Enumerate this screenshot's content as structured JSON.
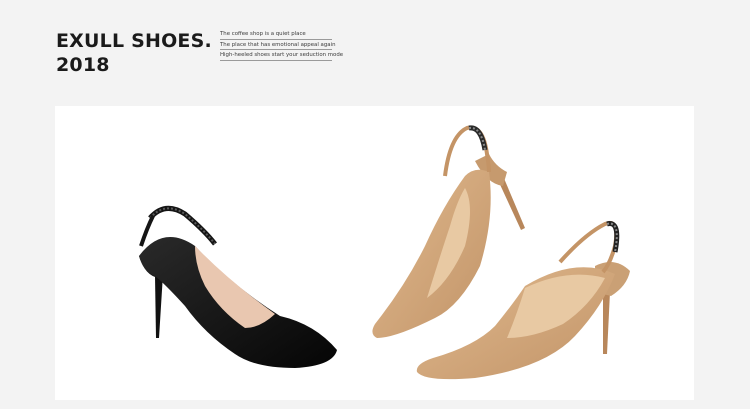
{
  "header": {
    "brand_line1": "EXULL SHOES.",
    "brand_line2": "2018",
    "taglines": [
      "The coffee shop is a quiet place",
      "The place that has emotional appeal again",
      "High-heeled shoes start your seduction mode"
    ]
  },
  "product_image": {
    "subject": "pointed-toe slingback high heels with jeweled strap",
    "colors": {
      "black_shoe": "#111111",
      "nude_shoe": "#d1a77b",
      "background": "#ffffff",
      "page": "#f3f3f3"
    }
  }
}
